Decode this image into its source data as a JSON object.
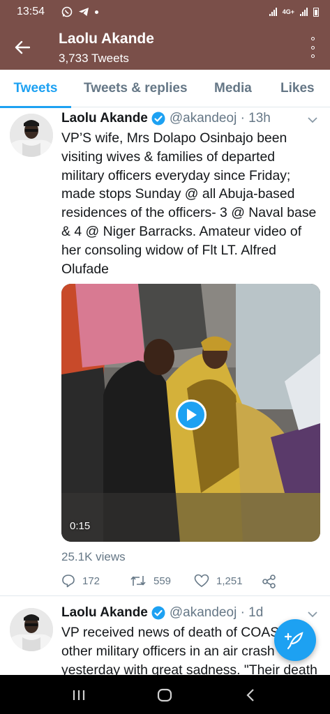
{
  "status_bar": {
    "time": "13:54",
    "network": "4G+"
  },
  "header": {
    "title": "Laolu Akande",
    "subtitle": "3,733 Tweets"
  },
  "tabs": [
    {
      "label": "Tweets",
      "active": true
    },
    {
      "label": "Tweets & replies",
      "active": false
    },
    {
      "label": "Media",
      "active": false
    },
    {
      "label": "Likes",
      "active": false
    }
  ],
  "tweets": [
    {
      "name": "Laolu Akande",
      "handle": "@akandeoj · 13h",
      "text_lines": [
        "VP’S wife, Mrs Dolapo Osinbajo been",
        "visiting wives & families of departed",
        "military officers everyday since Friday;",
        "made stops Sunday @ all Abuja-based",
        "residences of the officers- 3 @ Naval base",
        "& 4 @ Niger Barracks. Amateur video of",
        "her consoling widow of  Flt LT. Alfred",
        "Olufade"
      ],
      "video_duration": "0:15",
      "views": "25.1K views",
      "replies": "172",
      "retweets": "559",
      "likes": "1,251"
    },
    {
      "name": "Laolu Akande",
      "handle": "@akandeoj · 1d",
      "text_lines": [
        "VP received news of death of COAS",
        "other military officers in an air crash",
        "yesterday with great sadness. \"Their death"
      ]
    }
  ],
  "colors": {
    "header_bg": "#7a4f49",
    "accent": "#1da1f2",
    "secondary_text": "#657786",
    "nav_bg": "#000000"
  }
}
